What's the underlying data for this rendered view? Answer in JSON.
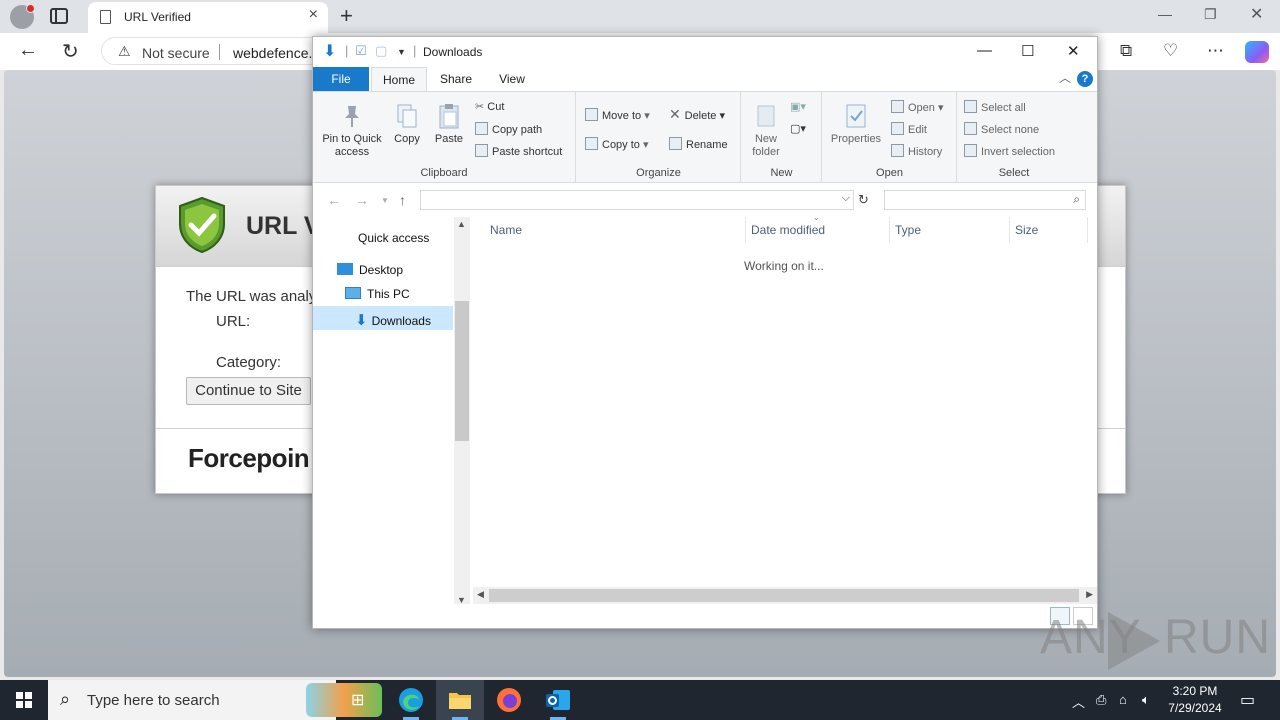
{
  "browser": {
    "tab_title": "URL Verified",
    "address_security": "Not secure",
    "address_url": "webdefence.g"
  },
  "forcepoint_page": {
    "title": "URL V",
    "analyzed_text": "The URL was analy",
    "url_label": "URL:",
    "category_label": "Category:",
    "continue_button": "Continue to Site",
    "brand": "Forcepoin"
  },
  "explorer": {
    "title": "Downloads",
    "ribbon_tabs": {
      "file": "File",
      "home": "Home",
      "share": "Share",
      "view": "View"
    },
    "help": "?",
    "clipboard": {
      "pin": "Pin to Quick access",
      "copy": "Copy",
      "paste": "Paste",
      "cut": "Cut",
      "copy_path": "Copy path",
      "paste_shortcut": "Paste shortcut",
      "label": "Clipboard"
    },
    "organize": {
      "move_to": "Move to",
      "copy_to": "Copy to",
      "delete": "Delete",
      "rename": "Rename",
      "label": "Organize"
    },
    "new": {
      "new_folder": "New folder",
      "label": "New"
    },
    "open": {
      "properties": "Properties",
      "open": "Open",
      "edit": "Edit",
      "history": "History",
      "label": "Open"
    },
    "select": {
      "select_all": "Select all",
      "select_none": "Select none",
      "invert": "Invert selection",
      "label": "Select"
    },
    "nav": {
      "quick_access": "Quick access",
      "desktop": "Desktop",
      "this_pc": "This PC",
      "downloads": "Downloads"
    },
    "columns": {
      "name": "Name",
      "date_modified": "Date modified",
      "type": "Type",
      "size": "Size"
    },
    "status_message": "Working on it..."
  },
  "watermark": {
    "left": "ANY",
    "right": "RUN"
  },
  "taskbar": {
    "search_placeholder": "Type here to search",
    "time": "3:20 PM",
    "date": "7/29/2024"
  }
}
